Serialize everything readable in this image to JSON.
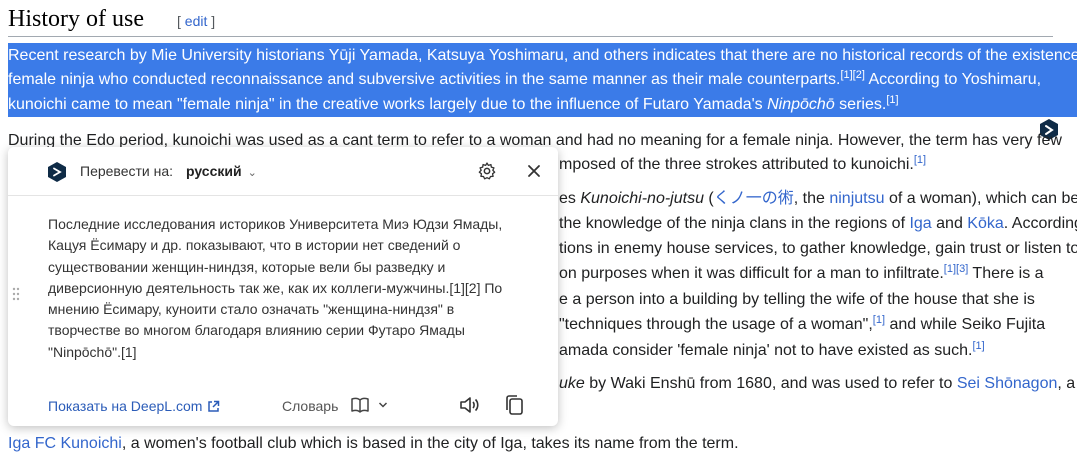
{
  "heading": {
    "title": "History of use",
    "edit_open": "[ ",
    "edit_label": "edit",
    "edit_close": " ]"
  },
  "selected_paragraph": {
    "line1": "Recent research by Mie University historians Yūji Yamada, Katsuya Yoshimaru, and others indicates that there are no historical records of the existence of",
    "line2_a": "female ninja who conducted reconnaissance and subversive activities in the same manner as their male counterparts.",
    "line2_ref": "[1][2]",
    "line2_b": " According to Yoshimaru,",
    "line3_a": "kunoichi came to mean \"female ninja\" in the creative works largely due to the influence of Futaro Yamada's ",
    "line3_italic": "Ninpōchō",
    "line3_b": " series.",
    "line3_ref": "[1]"
  },
  "paragraph2": {
    "line1": "During the Edo period, kunoichi was used as a cant term to refer to a woman and had no meaning for a female ninja. However, the term has very few",
    "line2_a": "mposed of the three strokes attributed to kunoichi.",
    "line2_ref": "[1]",
    "line3_a": "es ",
    "line3_italic": "Kunoichi-no-jutsu",
    "line3_b": " (",
    "line3_jp": "くノ一の術",
    "line3_c": ", the ",
    "line3_link": "ninjutsu",
    "line3_d": " of a woman), which can be",
    "line4_a": "the knowledge of the ninja clans in the regions of ",
    "line4_link1": "Iga",
    "line4_b": " and ",
    "line4_link2": "Kōka",
    "line4_c": ". According",
    "line5": "tions in enemy house services, to gather knowledge, gain trust or listen to",
    "line6_a": "on purposes when it was difficult for a man to infiltrate.",
    "line6_ref": "[1][3]",
    "line6_b": " There is a",
    "line7": "e a person into a building by telling the wife of the house that she is",
    "line8_a": "\"techniques through the usage of a woman\",",
    "line8_ref": "[1]",
    "line8_b": " and while Seiko Fujita",
    "line9_a": "amada consider 'female ninja' not to have existed as such.",
    "line9_ref": "[1]",
    "line10_italic": "uke",
    "line10_a": " by Waki Enshū from 1680, and was used to refer to ",
    "line10_link": "Sei Shōnagon",
    "line10_b": ", a"
  },
  "last_line": {
    "link": "Iga FC Kunoichi",
    "text": ", a women's football club which is based in the city of Iga, takes its name from the term."
  },
  "popup": {
    "translate_to_label": "Перевести на:",
    "target_language": "русский",
    "translation_lines": [
      "Последние исследования историков Университета Миэ Юдзи Ямады,",
      "Кацуя Ёсимару и др. показывают, что в истории нет сведений о",
      "существовании женщин-ниндзя, которые вели бы разведку и",
      "диверсионную деятельность так же, как их коллеги-мужчины.[1][2] По",
      "мнению Ёсимару, куноити стало означать \"женщина-ниндзя\" в",
      "творчестве во многом благодаря влиянию серии Футаро Ямады",
      "\"Ninpōchō\".[1]"
    ],
    "show_on_deepl": "Показать на DeepL.com",
    "dictionary_label": "Словарь"
  },
  "colors": {
    "selection": "#3b7be8",
    "link": "#3366cc",
    "deepl_dark": "#0f2b46"
  },
  "icons": [
    "deepl-logo-icon",
    "chevron-down-icon",
    "gear-icon",
    "close-icon",
    "drag-handle-icon",
    "external-link-icon",
    "book-icon",
    "speaker-icon",
    "copy-icon"
  ]
}
